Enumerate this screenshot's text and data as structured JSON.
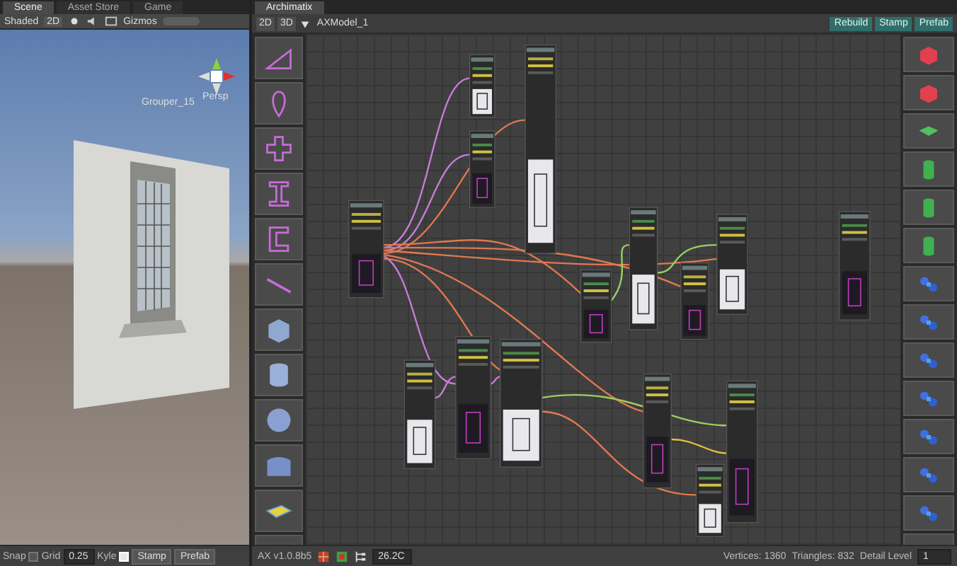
{
  "scene_tabs": [
    {
      "label": "Scene",
      "selected": true
    },
    {
      "label": "Asset Store",
      "selected": false
    },
    {
      "label": "Game",
      "selected": false
    }
  ],
  "scene_toolbar": {
    "shading": "Shaded",
    "mode": "2D",
    "gizmos": "Gizmos"
  },
  "scene_view": {
    "object_label": "Grouper_15",
    "projection": "Persp"
  },
  "scene_footer": {
    "snap_label": "Snap",
    "snap_checked": false,
    "grid_label": "Grid",
    "grid_value": "0.25",
    "kyle_label": "Kyle",
    "kyle_checked": true,
    "buttons": [
      "Stamp",
      "Prefab"
    ]
  },
  "ax_tab": {
    "label": "Archimatix"
  },
  "ax_toolbar": {
    "view_buttons": [
      {
        "label": "2D",
        "selected": false
      },
      {
        "label": "3D",
        "selected": false
      }
    ],
    "model": "AXModel_1",
    "actions": [
      "Rebuild",
      "Stamp",
      "Prefab"
    ]
  },
  "ax_footer": {
    "version": "AX v1.0.8b5",
    "zoom": "26.2C",
    "vertices": "Vertices: 1360",
    "triangles": "Triangles: 832",
    "detail_label": "Detail Level",
    "detail_value": "1"
  }
}
